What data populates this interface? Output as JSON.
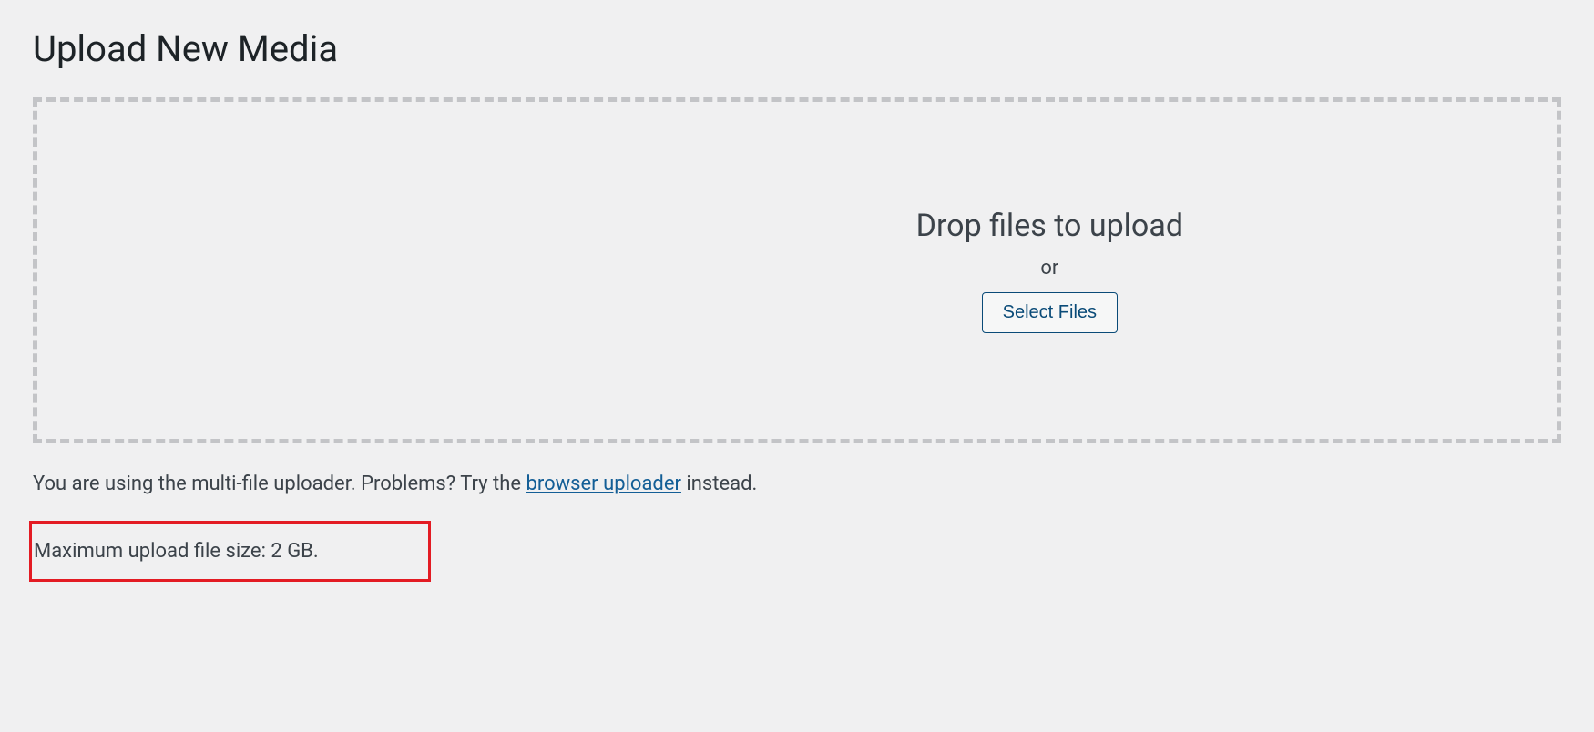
{
  "page": {
    "title": "Upload New Media"
  },
  "dropzone": {
    "heading": "Drop files to upload",
    "or": "or",
    "select_button": "Select Files"
  },
  "info": {
    "uploader_text_pre": "You are using the multi-file uploader. Problems? Try the ",
    "browser_uploader_link": "browser uploader",
    "uploader_text_post": " instead."
  },
  "limits": {
    "max_upload_text": "Maximum upload file size: 2 GB."
  }
}
